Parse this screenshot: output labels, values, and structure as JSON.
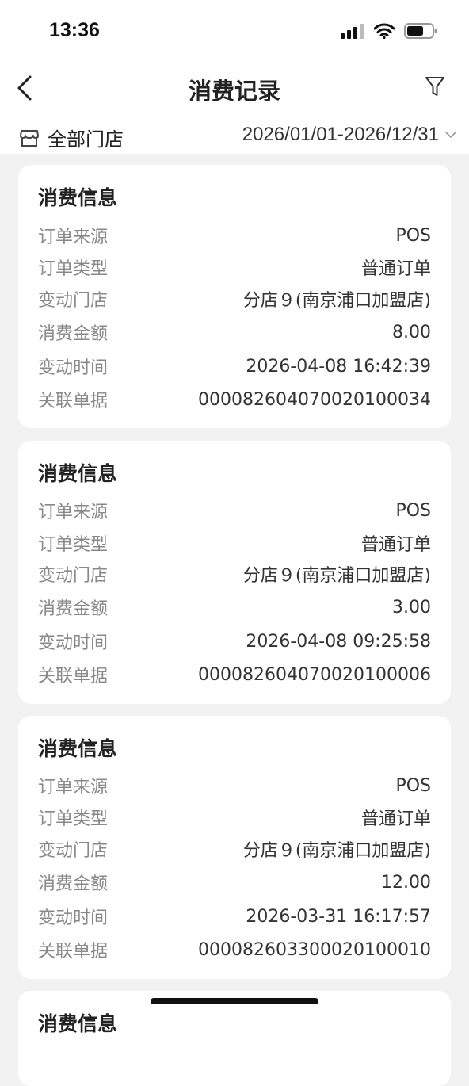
{
  "status": {
    "time": "13:36"
  },
  "header": {
    "title": "消费记录"
  },
  "filter": {
    "store": "全部门店",
    "date_range": "2026/01/01-2026/12/31"
  },
  "labels": {
    "card_title": "消费信息",
    "order_source": "订单来源",
    "order_type": "订单类型",
    "change_store": "变动门店",
    "amount": "消费金额",
    "change_time": "变动时间",
    "related_doc": "关联单据"
  },
  "records": [
    {
      "source": "POS",
      "type": "普通订单",
      "store": "分店９(南京浦口加盟店)",
      "amount": "8.00",
      "time": "2026-04-08 16:42:39",
      "doc": "000082604070020100034"
    },
    {
      "source": "POS",
      "type": "普通订单",
      "store": "分店９(南京浦口加盟店)",
      "amount": "3.00",
      "time": "2026-04-08 09:25:58",
      "doc": "000082604070020100006"
    },
    {
      "source": "POS",
      "type": "普通订单",
      "store": "分店９(南京浦口加盟店)",
      "amount": "12.00",
      "time": "2026-03-31 16:17:57",
      "doc": "000082603300020100010"
    },
    {
      "source": "",
      "type": "",
      "store": "",
      "amount": "",
      "time": "",
      "doc": ""
    }
  ]
}
